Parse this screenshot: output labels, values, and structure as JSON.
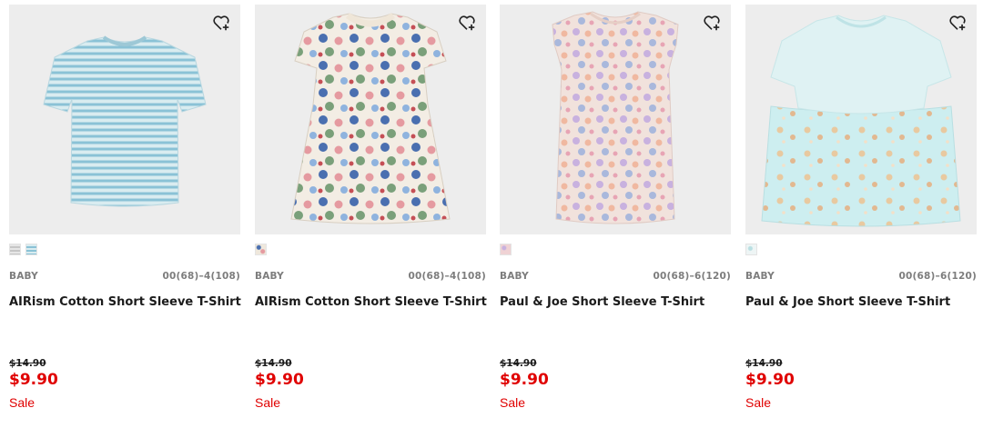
{
  "colors": {
    "sale_red": "#e00000",
    "image_bg": "#ededed",
    "meta_gray": "#7d7d7d"
  },
  "products": [
    {
      "category": "BABY",
      "sizes": "00(68)–4(108)",
      "name": "AIRism Cotton Short Sleeve T-Shirt",
      "original_price": "$14.90",
      "price": "$9.90",
      "flag": "Sale",
      "swatches": [
        "#dcdcdc",
        "#8fc3d8"
      ],
      "icon": "heart-plus-icon"
    },
    {
      "category": "BABY",
      "sizes": "00(68)–4(108)",
      "name": "AIRism Cotton Short Sleeve T-Shirt",
      "original_price": "$14.90",
      "price": "$9.90",
      "flag": "Sale",
      "swatches": [
        "#b8c8dc"
      ],
      "icon": "heart-plus-icon"
    },
    {
      "category": "BABY",
      "sizes": "00(68)–6(120)",
      "name": "Paul & Joe Short Sleeve T-Shirt",
      "original_price": "$14.90",
      "price": "$9.90",
      "flag": "Sale",
      "swatches": [
        "#e8c8cc"
      ],
      "icon": "heart-plus-icon"
    },
    {
      "category": "BABY",
      "sizes": "00(68)–6(120)",
      "name": "Paul & Joe Short Sleeve T-Shirt",
      "original_price": "$14.90",
      "price": "$9.90",
      "flag": "Sale",
      "swatches": [
        "#dfeaec"
      ],
      "icon": "heart-plus-icon"
    }
  ]
}
